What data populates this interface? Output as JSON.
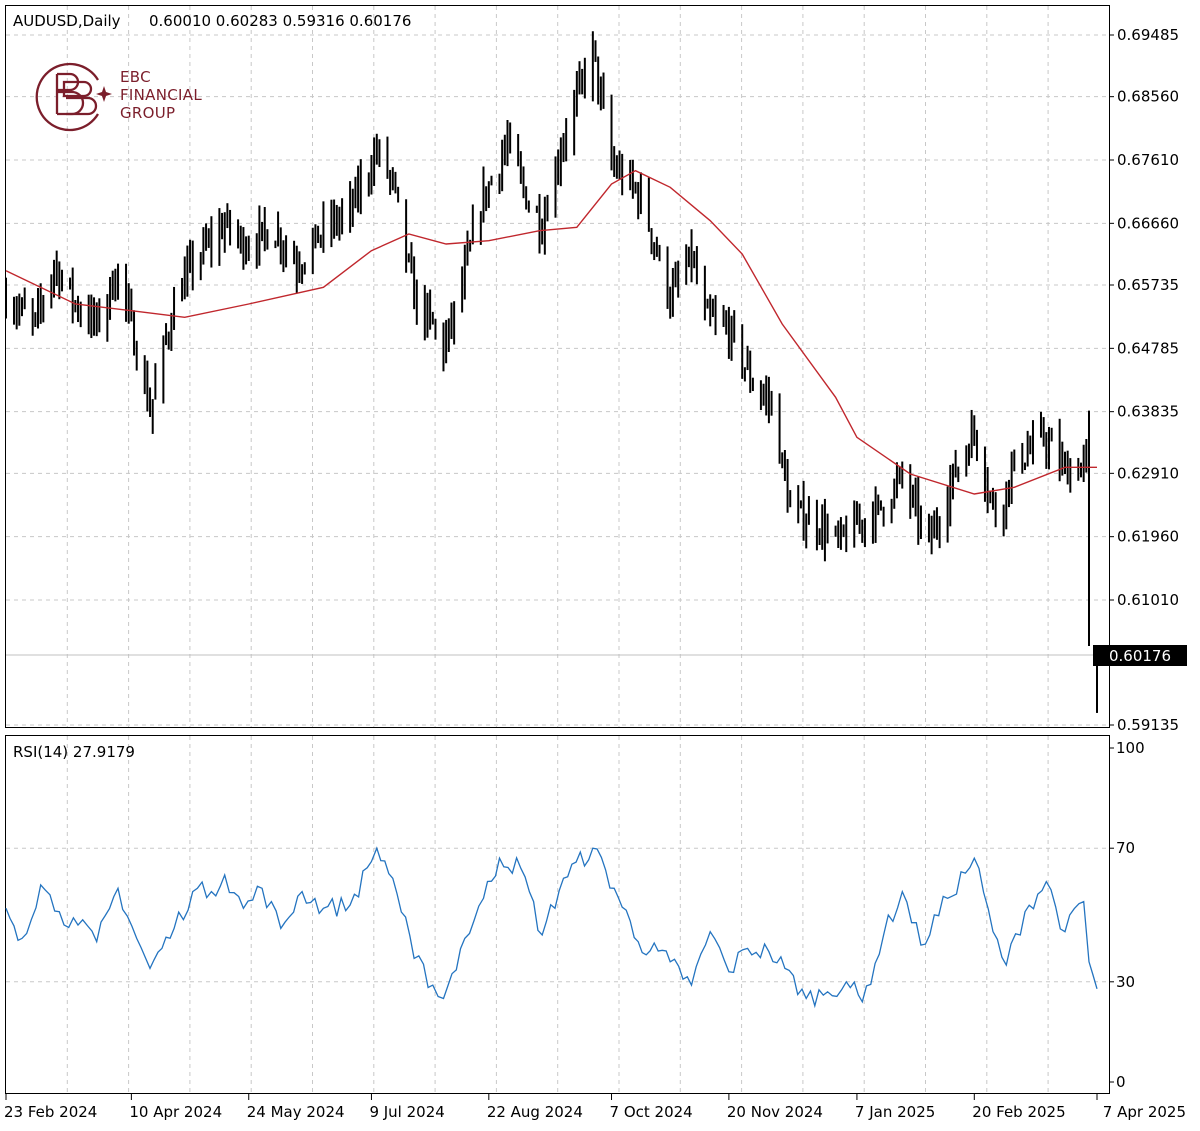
{
  "header": {
    "symbol_line": "AUDUSD,Daily",
    "ohlc_line": "0.60010 0.60283 0.59316 0.60176"
  },
  "logo": {
    "line1": "EBC",
    "line2": "FINANCIAL",
    "line3": "GROUP",
    "brand_color": "#7b1e2b",
    "icon": "ebc-monogram-icon"
  },
  "rsi_label": "RSI(14) 27.9179",
  "current_price_tag": "0.60176",
  "colors": {
    "bars": "#000000",
    "moving_average": "#c0272d",
    "rsi_line": "#2474c0",
    "grid": "#c8c8c8",
    "price_tag_bg": "#000000",
    "price_tag_text": "#ffffff"
  },
  "chart_data": [
    {
      "type": "ohlc_bar",
      "symbol": "AUDUSD",
      "timeframe": "Daily",
      "ylim": [
        0.59135,
        0.69485
      ],
      "y_ticks": [
        "0.69485",
        "0.68560",
        "0.67610",
        "0.66660",
        "0.65735",
        "0.64785",
        "0.63835",
        "0.62910",
        "0.61960",
        "0.61010",
        "0.59135"
      ],
      "x_ticks": [
        "23 Feb 2024",
        "10 Apr 2024",
        "24 May 2024",
        "9 Jul 2024",
        "22 Aug 2024",
        "7 Oct 2024",
        "20 Nov 2024",
        "7 Jan 2025",
        "20 Feb 2025",
        "7 Apr 2025"
      ],
      "last_bar": {
        "open": 0.6001,
        "high": 0.60283,
        "low": 0.59316,
        "close": 0.60176
      },
      "close_path": [
        {
          "date": "2024-02-23",
          "close": 0.6555
        },
        {
          "date": "2024-03-05",
          "close": 0.6515
        },
        {
          "date": "2024-03-12",
          "close": 0.6605
        },
        {
          "date": "2024-03-20",
          "close": 0.6545
        },
        {
          "date": "2024-03-28",
          "close": 0.6515
        },
        {
          "date": "2024-04-05",
          "close": 0.6595
        },
        {
          "date": "2024-04-12",
          "close": 0.6475
        },
        {
          "date": "2024-04-17",
          "close": 0.6385
        },
        {
          "date": "2024-04-26",
          "close": 0.6545
        },
        {
          "date": "2024-05-03",
          "close": 0.6605
        },
        {
          "date": "2024-05-15",
          "close": 0.6665
        },
        {
          "date": "2024-05-22",
          "close": 0.6635
        },
        {
          "date": "2024-06-03",
          "close": 0.6655
        },
        {
          "date": "2024-06-11",
          "close": 0.6605
        },
        {
          "date": "2024-06-21",
          "close": 0.6655
        },
        {
          "date": "2024-07-01",
          "close": 0.6685
        },
        {
          "date": "2024-07-11",
          "close": 0.6775
        },
        {
          "date": "2024-07-17",
          "close": 0.6725
        },
        {
          "date": "2024-07-25",
          "close": 0.6555
        },
        {
          "date": "2024-08-02",
          "close": 0.6505
        },
        {
          "date": "2024-08-05",
          "close": 0.6475
        },
        {
          "date": "2024-08-12",
          "close": 0.6575
        },
        {
          "date": "2024-08-19",
          "close": 0.6695
        },
        {
          "date": "2024-08-29",
          "close": 0.6785
        },
        {
          "date": "2024-09-06",
          "close": 0.6695
        },
        {
          "date": "2024-09-11",
          "close": 0.6665
        },
        {
          "date": "2024-09-19",
          "close": 0.6795
        },
        {
          "date": "2024-09-30",
          "close": 0.6925
        },
        {
          "date": "2024-10-07",
          "close": 0.6755
        },
        {
          "date": "2024-10-18",
          "close": 0.6705
        },
        {
          "date": "2024-10-29",
          "close": 0.6555
        },
        {
          "date": "2024-11-06",
          "close": 0.6615
        },
        {
          "date": "2024-11-11",
          "close": 0.6525
        },
        {
          "date": "2024-11-20",
          "close": 0.6505
        },
        {
          "date": "2024-11-29",
          "close": 0.6425
        },
        {
          "date": "2024-12-06",
          "close": 0.6395
        },
        {
          "date": "2024-12-13",
          "close": 0.6235
        },
        {
          "date": "2024-12-24",
          "close": 0.6215
        },
        {
          "date": "2024-12-31",
          "close": 0.6185
        },
        {
          "date": "2025-01-07",
          "close": 0.6215
        },
        {
          "date": "2025-01-15",
          "close": 0.6235
        },
        {
          "date": "2025-01-24",
          "close": 0.6285
        },
        {
          "date": "2025-02-03",
          "close": 0.6185
        },
        {
          "date": "2025-02-12",
          "close": 0.6285
        },
        {
          "date": "2025-02-20",
          "close": 0.6355
        },
        {
          "date": "2025-02-28",
          "close": 0.6225
        },
        {
          "date": "2025-03-07",
          "close": 0.6305
        },
        {
          "date": "2025-03-18",
          "close": 0.6345
        },
        {
          "date": "2025-03-26",
          "close": 0.6295
        },
        {
          "date": "2025-04-03",
          "close": 0.6305
        },
        {
          "date": "2025-04-07",
          "close": 0.6018
        }
      ],
      "moving_average": [
        {
          "date": "2024-02-23",
          "value": 0.6595
        },
        {
          "date": "2024-03-20",
          "value": 0.6545
        },
        {
          "date": "2024-04-10",
          "value": 0.6535
        },
        {
          "date": "2024-04-30",
          "value": 0.6525
        },
        {
          "date": "2024-05-24",
          "value": 0.6545
        },
        {
          "date": "2024-06-21",
          "value": 0.657
        },
        {
          "date": "2024-07-09",
          "value": 0.6625
        },
        {
          "date": "2024-07-23",
          "value": 0.665
        },
        {
          "date": "2024-08-06",
          "value": 0.6635
        },
        {
          "date": "2024-08-22",
          "value": 0.664
        },
        {
          "date": "2024-09-10",
          "value": 0.6655
        },
        {
          "date": "2024-09-24",
          "value": 0.666
        },
        {
          "date": "2024-10-07",
          "value": 0.6725
        },
        {
          "date": "2024-10-16",
          "value": 0.6745
        },
        {
          "date": "2024-10-29",
          "value": 0.672
        },
        {
          "date": "2024-11-13",
          "value": 0.667
        },
        {
          "date": "2024-11-25",
          "value": 0.662
        },
        {
          "date": "2024-12-10",
          "value": 0.6515
        },
        {
          "date": "2024-12-30",
          "value": 0.6405
        },
        {
          "date": "2025-01-07",
          "value": 0.6345
        },
        {
          "date": "2025-01-27",
          "value": 0.629
        },
        {
          "date": "2025-02-20",
          "value": 0.626
        },
        {
          "date": "2025-03-07",
          "value": 0.627
        },
        {
          "date": "2025-03-26",
          "value": 0.63
        },
        {
          "date": "2025-04-07",
          "value": 0.63
        }
      ]
    },
    {
      "type": "line",
      "name": "RSI(14)",
      "last_value": 27.9179,
      "ylim": [
        0,
        100
      ],
      "y_ticks": [
        "100",
        "70",
        "30",
        "0"
      ],
      "points": [
        {
          "date": "2024-02-23",
          "value": 52
        },
        {
          "date": "2024-02-29",
          "value": 43
        },
        {
          "date": "2024-03-07",
          "value": 59
        },
        {
          "date": "2024-03-14",
          "value": 51
        },
        {
          "date": "2024-03-21",
          "value": 47
        },
        {
          "date": "2024-03-28",
          "value": 42
        },
        {
          "date": "2024-04-05",
          "value": 58
        },
        {
          "date": "2024-04-12",
          "value": 43
        },
        {
          "date": "2024-04-17",
          "value": 34
        },
        {
          "date": "2024-04-26",
          "value": 46
        },
        {
          "date": "2024-05-03",
          "value": 57
        },
        {
          "date": "2024-05-10",
          "value": 57
        },
        {
          "date": "2024-05-15",
          "value": 62
        },
        {
          "date": "2024-05-22",
          "value": 52
        },
        {
          "date": "2024-05-29",
          "value": 58
        },
        {
          "date": "2024-06-05",
          "value": 46
        },
        {
          "date": "2024-06-13",
          "value": 57
        },
        {
          "date": "2024-06-21",
          "value": 52
        },
        {
          "date": "2024-07-01",
          "value": 53
        },
        {
          "date": "2024-07-09",
          "value": 66
        },
        {
          "date": "2024-07-11",
          "value": 70
        },
        {
          "date": "2024-07-17",
          "value": 61
        },
        {
          "date": "2024-07-25",
          "value": 37
        },
        {
          "date": "2024-08-01",
          "value": 29
        },
        {
          "date": "2024-08-05",
          "value": 25
        },
        {
          "date": "2024-08-13",
          "value": 43
        },
        {
          "date": "2024-08-20",
          "value": 55
        },
        {
          "date": "2024-08-26",
          "value": 67
        },
        {
          "date": "2024-09-03",
          "value": 64
        },
        {
          "date": "2024-09-11",
          "value": 44
        },
        {
          "date": "2024-09-19",
          "value": 61
        },
        {
          "date": "2024-09-30",
          "value": 70
        },
        {
          "date": "2024-10-08",
          "value": 58
        },
        {
          "date": "2024-10-17",
          "value": 42
        },
        {
          "date": "2024-10-29",
          "value": 36
        },
        {
          "date": "2024-11-06",
          "value": 29
        },
        {
          "date": "2024-11-13",
          "value": 45
        },
        {
          "date": "2024-11-20",
          "value": 33
        },
        {
          "date": "2024-11-27",
          "value": 40
        },
        {
          "date": "2024-12-05",
          "value": 39
        },
        {
          "date": "2024-12-11",
          "value": 34
        },
        {
          "date": "2024-12-19",
          "value": 25
        },
        {
          "date": "2024-12-27",
          "value": 27
        },
        {
          "date": "2025-01-03",
          "value": 30
        },
        {
          "date": "2025-01-09",
          "value": 24
        },
        {
          "date": "2025-01-17",
          "value": 44
        },
        {
          "date": "2025-01-24",
          "value": 57
        },
        {
          "date": "2025-01-31",
          "value": 41
        },
        {
          "date": "2025-02-10",
          "value": 55
        },
        {
          "date": "2025-02-20",
          "value": 67
        },
        {
          "date": "2025-02-27",
          "value": 45
        },
        {
          "date": "2025-03-04",
          "value": 35
        },
        {
          "date": "2025-03-11",
          "value": 51
        },
        {
          "date": "2025-03-19",
          "value": 60
        },
        {
          "date": "2025-03-26",
          "value": 45
        },
        {
          "date": "2025-04-02",
          "value": 54
        },
        {
          "date": "2025-04-04",
          "value": 36
        },
        {
          "date": "2025-04-07",
          "value": 27.9179
        }
      ]
    }
  ]
}
